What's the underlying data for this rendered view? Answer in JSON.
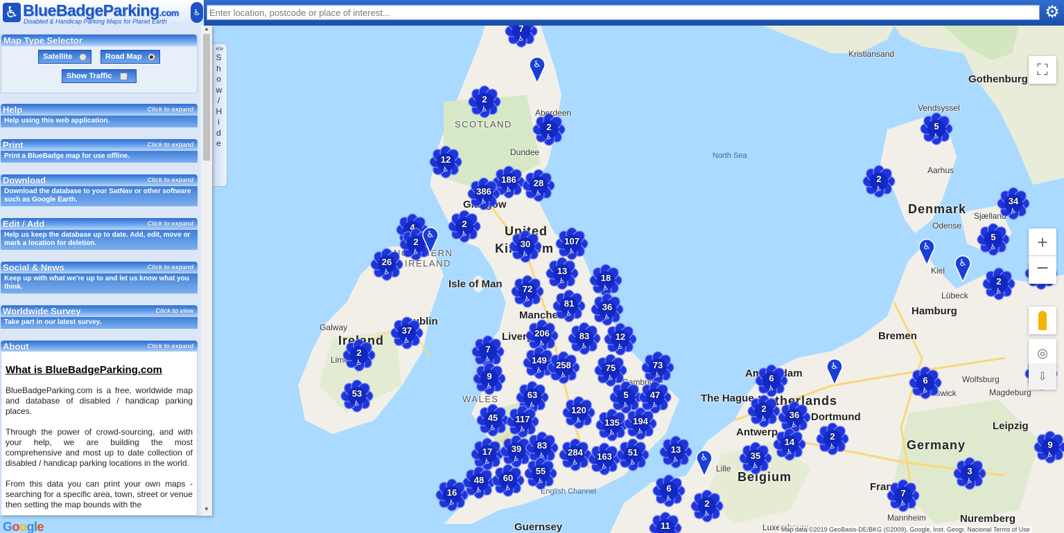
{
  "header": {
    "brand": "BlueBadgeParking",
    "brand_suffix": ".com",
    "tagline": "Disabled & Handicap Parking Maps for Planet Earth",
    "search_placeholder": "Enter location, postcode or place of interest..."
  },
  "panel": {
    "map_type": {
      "title": "Map Type Selector",
      "satellite": "Satellite",
      "road_map": "Road Map",
      "selected": "Road Map",
      "show_traffic": "Show Traffic",
      "traffic_on": false
    },
    "sections": [
      {
        "title": "Help",
        "hint": "Click to expand",
        "desc": "Help using this web application."
      },
      {
        "title": "Print",
        "hint": "Click to expand",
        "desc": "Print a BlueBadge map for use offline."
      },
      {
        "title": "Download",
        "hint": "Click to expand",
        "desc": "Download the database to your SatNav or other software such as Google Earth."
      },
      {
        "title": "Edit / Add",
        "hint": "Click to expand",
        "desc": "Help us keep the database up to date. Add, edit, move or mark a location for deletion."
      },
      {
        "title": "Social & News",
        "hint": "Click to expand",
        "desc": "Keep up with what we're up to and let us know what you think."
      },
      {
        "title": "Worldwide Survey",
        "hint": "Click to view",
        "desc": "Take part in our latest survey."
      },
      {
        "title": "About",
        "hint": "Click to expand",
        "desc": ""
      }
    ],
    "about": {
      "heading": "What is BlueBadgeParking.com",
      "p1": "BlueBadgeParking.com is a free, worldwide map and database of disabled / handicap parking places.",
      "p2": "Through the power of crowd-sourcing, and with your help, we are building the most comprehensive and most up to date collection of disabled / handicap parking locations in the world.",
      "p3": "From this data you can print your own maps - searching for a specific area, town, street or venue then setting the map bounds with the"
    },
    "show_hide": "Show / Hide",
    "show_hide_arrows": "«»"
  },
  "map": {
    "labels": [
      {
        "text": "Kristiansand",
        "cls": ""
      },
      {
        "text": "Gothenburg",
        "cls": "mid"
      },
      {
        "text": "Vendsyssel",
        "cls": ""
      },
      {
        "text": "Aarhus",
        "cls": ""
      },
      {
        "text": "Denmark",
        "cls": "big"
      },
      {
        "text": "Odense",
        "cls": ""
      },
      {
        "text": "Sjælland",
        "cls": ""
      },
      {
        "text": "Kiel",
        "cls": ""
      },
      {
        "text": "Lübeck",
        "cls": ""
      },
      {
        "text": "Hamburg",
        "cls": "mid"
      },
      {
        "text": "Bremen",
        "cls": "mid"
      },
      {
        "text": "Wolfsburg",
        "cls": ""
      },
      {
        "text": "Brunswick",
        "cls": ""
      },
      {
        "text": "Magdeburg",
        "cls": ""
      },
      {
        "text": "Dortmund",
        "cls": "mid"
      },
      {
        "text": "Leipzig",
        "cls": "mid"
      },
      {
        "text": "Germany",
        "cls": "big"
      },
      {
        "text": "Mannheim",
        "cls": ""
      },
      {
        "text": "Nuremberg",
        "cls": "mid"
      },
      {
        "text": "Luxembourg",
        "cls": ""
      },
      {
        "text": "Belgium",
        "cls": "big"
      },
      {
        "text": "Lille",
        "cls": ""
      },
      {
        "text": "Antwerp",
        "cls": "mid"
      },
      {
        "text": "The Hague",
        "cls": "mid"
      },
      {
        "text": "Netherlands",
        "cls": "big"
      },
      {
        "text": "Amsterdam",
        "cls": "mid"
      },
      {
        "text": "North Sea",
        "cls": "sea"
      },
      {
        "text": "English Channel",
        "cls": "sea"
      },
      {
        "text": "Aberdeen",
        "cls": ""
      },
      {
        "text": "SCOTLAND",
        "cls": "cap"
      },
      {
        "text": "Dundee",
        "cls": ""
      },
      {
        "text": "Glasgow",
        "cls": "mid"
      },
      {
        "text": "United",
        "cls": "big"
      },
      {
        "text": "Kingdom",
        "cls": "big"
      },
      {
        "text": "NORTHERN",
        "cls": "cap"
      },
      {
        "text": "IRELAND",
        "cls": "cap"
      },
      {
        "text": "Isle of Man",
        "cls": "mid"
      },
      {
        "text": "Manchester",
        "cls": "mid"
      },
      {
        "text": "Liverpool",
        "cls": "mid"
      },
      {
        "text": "Galway",
        "cls": ""
      },
      {
        "text": "Ireland",
        "cls": "big"
      },
      {
        "text": "Dublin",
        "cls": "mid"
      },
      {
        "text": "Limerick",
        "cls": ""
      },
      {
        "text": "WALES",
        "cls": "cap"
      },
      {
        "text": "Cambridge",
        "cls": ""
      },
      {
        "text": "Frankfurt",
        "cls": "mid"
      },
      {
        "text": "Guernsey",
        "cls": "mid"
      }
    ],
    "clusters": [
      "7",
      "2",
      "2",
      "12",
      "186",
      "28",
      "386",
      "2",
      "4",
      "2",
      "30",
      "107",
      "26",
      "13",
      "72",
      "18",
      "81",
      "36",
      "206",
      "83",
      "37",
      "12",
      "2",
      "7",
      "149",
      "258",
      "75",
      "73",
      "9",
      "53",
      "63",
      "5",
      "47",
      "45",
      "117",
      "120",
      "135",
      "194",
      "13",
      "17",
      "39",
      "83",
      "284",
      "163",
      "51",
      "48",
      "60",
      "55",
      "16",
      "5",
      "2",
      "34",
      "5",
      "2",
      "48",
      "6",
      "2",
      "36",
      "14",
      "35",
      "2",
      "6",
      "3",
      "7",
      "6",
      "2",
      "5",
      "9",
      "11"
    ],
    "attribution": "Map data ©2019 GeoBasis-DE/BKG (©2009), Google, Inst. Geogr. Nacional   Terms of Use"
  },
  "icons": {
    "wheelchair": "♿",
    "gear": "⚙",
    "fullscreen": "⛶",
    "zoom_in": "+",
    "zoom_out": "−",
    "locate": "◎",
    "walk": "⇩"
  },
  "colors": {
    "brand_blue": "#1d56c6",
    "cluster_blue": "#1b2fd6",
    "water": "#aadaff",
    "land": "#f2efe9"
  }
}
